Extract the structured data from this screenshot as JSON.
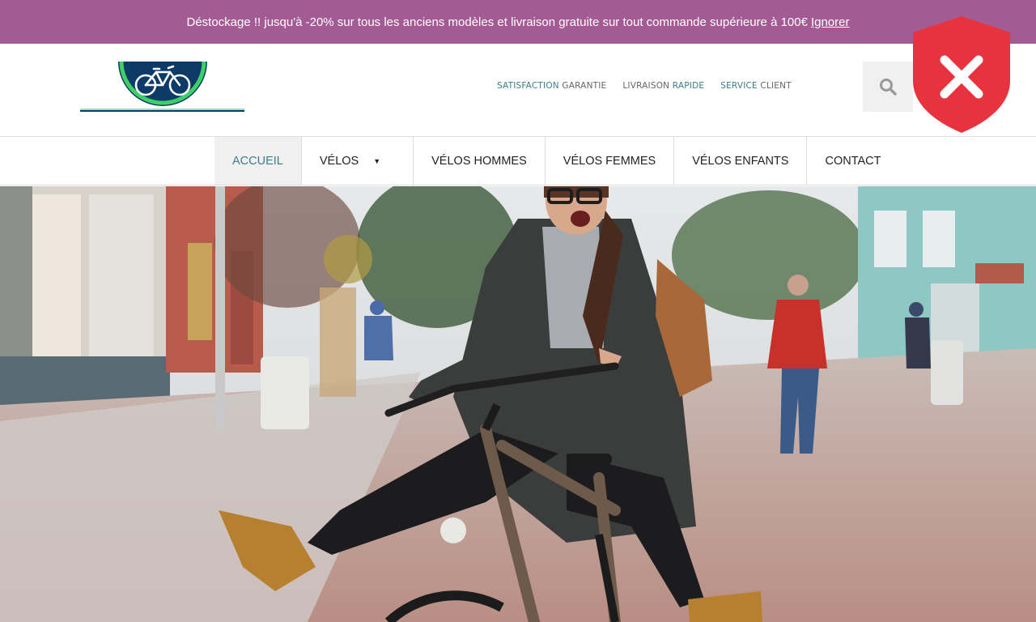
{
  "promo": {
    "text": "Déstockage !! jusqu'à -20% sur tous les anciens modèles et livraison gratuite sur tout commande supérieure à 100€",
    "dismiss_label": "Ignorer",
    "background": "#a35b94"
  },
  "header": {
    "trust": [
      {
        "hl": "SATISFACTION",
        "lo": "GARANTIE"
      },
      {
        "lo": "LIVRAISON",
        "hl": "RAPIDE"
      },
      {
        "hl": "SERVICE",
        "lo": "CLIENT"
      }
    ],
    "accent_color": "#3e7d8a"
  },
  "nav": {
    "items": [
      {
        "label": "Accueil"
      },
      {
        "label": "Vélos"
      },
      {
        "label": "Vélos hommes"
      },
      {
        "label": "Vélos femmes"
      },
      {
        "label": "Vélos enfants"
      },
      {
        "label": "Contact"
      }
    ]
  },
  "icons": {
    "search": "search-icon",
    "dropdown": "caret-down-icon",
    "shield": "shield-close-icon",
    "logo": "bicycle-logo"
  },
  "shield": {
    "color": "#e8333f"
  }
}
